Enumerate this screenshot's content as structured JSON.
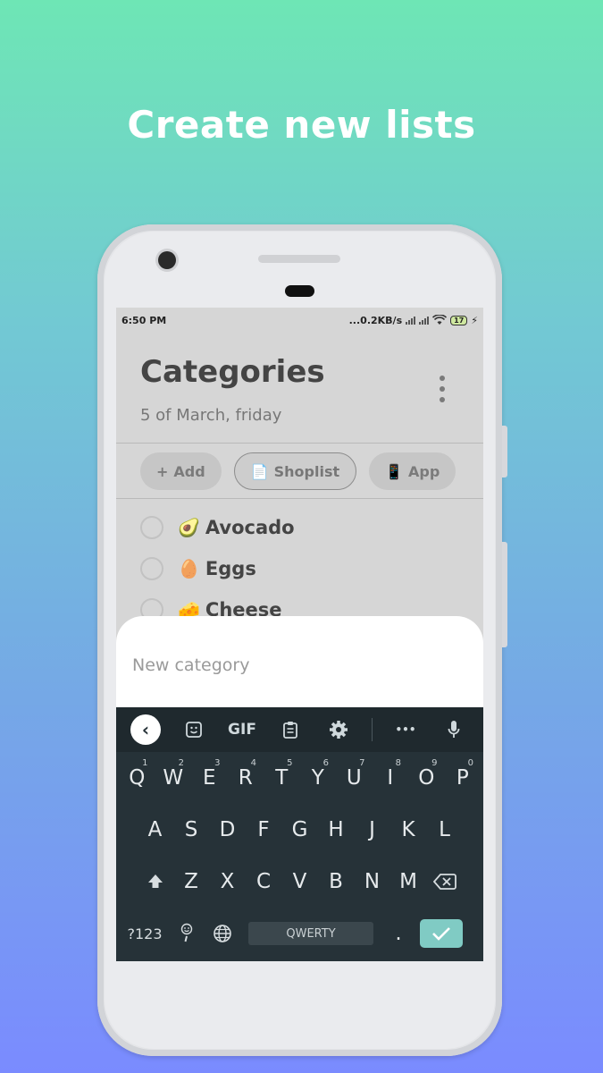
{
  "headline": "Create new lists",
  "status": {
    "time": "6:50 PM",
    "network_speed": "...0.2KB/s",
    "battery": "17"
  },
  "header": {
    "title": "Categories",
    "date": "5 of March, friday"
  },
  "chips": [
    {
      "icon": "+",
      "label": "Add",
      "active": false
    },
    {
      "icon": "📄",
      "label": "Shoplist",
      "active": true
    },
    {
      "icon": "📱",
      "label": "App",
      "active": false
    }
  ],
  "items": [
    {
      "emoji": "🥑",
      "label": "Avocado"
    },
    {
      "emoji": "🥚",
      "label": "Eggs"
    },
    {
      "emoji": "🧀",
      "label": "Cheese"
    }
  ],
  "new_category": {
    "placeholder": "New category"
  },
  "keyboard": {
    "toolbar": {
      "back_icon": "‹",
      "gif_label": "GIF",
      "more_icon": "•••"
    },
    "row1": [
      {
        "key": "Q",
        "hint": "1"
      },
      {
        "key": "W",
        "hint": "2"
      },
      {
        "key": "E",
        "hint": "3"
      },
      {
        "key": "R",
        "hint": "4"
      },
      {
        "key": "T",
        "hint": "5"
      },
      {
        "key": "Y",
        "hint": "6"
      },
      {
        "key": "U",
        "hint": "7"
      },
      {
        "key": "I",
        "hint": "8"
      },
      {
        "key": "O",
        "hint": "9"
      },
      {
        "key": "P",
        "hint": "0"
      }
    ],
    "row2": [
      "A",
      "S",
      "D",
      "F",
      "G",
      "H",
      "J",
      "K",
      "L"
    ],
    "row3": [
      "Z",
      "X",
      "C",
      "V",
      "B",
      "N",
      "M"
    ],
    "symbols_label": "?123",
    "space_label": "QWERTY",
    "period": "."
  }
}
